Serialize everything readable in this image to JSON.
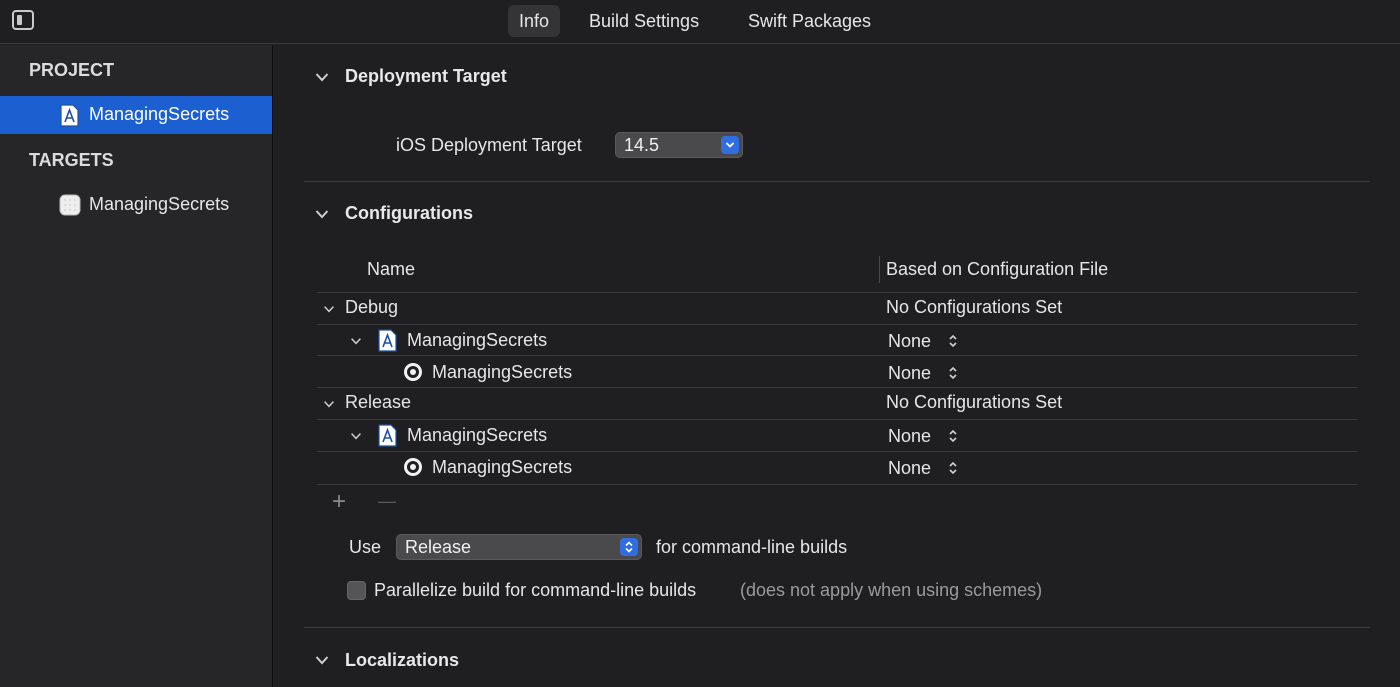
{
  "tabs": [
    {
      "label": "Info",
      "active": true
    },
    {
      "label": "Build Settings",
      "active": false
    },
    {
      "label": "Swift Packages",
      "active": false
    }
  ],
  "sidebar": {
    "project_heading": "PROJECT",
    "project_item": "ManagingSecrets",
    "targets_heading": "TARGETS",
    "target_item": "ManagingSecrets"
  },
  "deployment": {
    "title": "Deployment Target",
    "label": "iOS Deployment Target",
    "value": "14.5"
  },
  "configurations": {
    "title": "Configurations",
    "col_name": "Name",
    "col_file": "Based on Configuration File",
    "rows": [
      {
        "name": "Debug",
        "value": "No Configurations Set"
      },
      {
        "name": "ManagingSecrets",
        "value": "None"
      },
      {
        "name": "ManagingSecrets",
        "value": "None"
      },
      {
        "name": "Release",
        "value": "No Configurations Set"
      },
      {
        "name": "ManagingSecrets",
        "value": "None"
      },
      {
        "name": "ManagingSecrets",
        "value": "None"
      }
    ],
    "add_symbol": "+",
    "remove_symbol": "—",
    "use_label": "Use",
    "use_value": "Release",
    "use_suffix": "for command-line builds",
    "parallelize_label": "Parallelize build for command-line builds",
    "parallelize_hint": "(does not apply when using schemes)",
    "parallelize_checked": false
  },
  "localizations": {
    "title": "Localizations"
  },
  "colors": {
    "accent": "#1b5fd1",
    "background": "#1f1f21",
    "sidebar": "#262628"
  }
}
